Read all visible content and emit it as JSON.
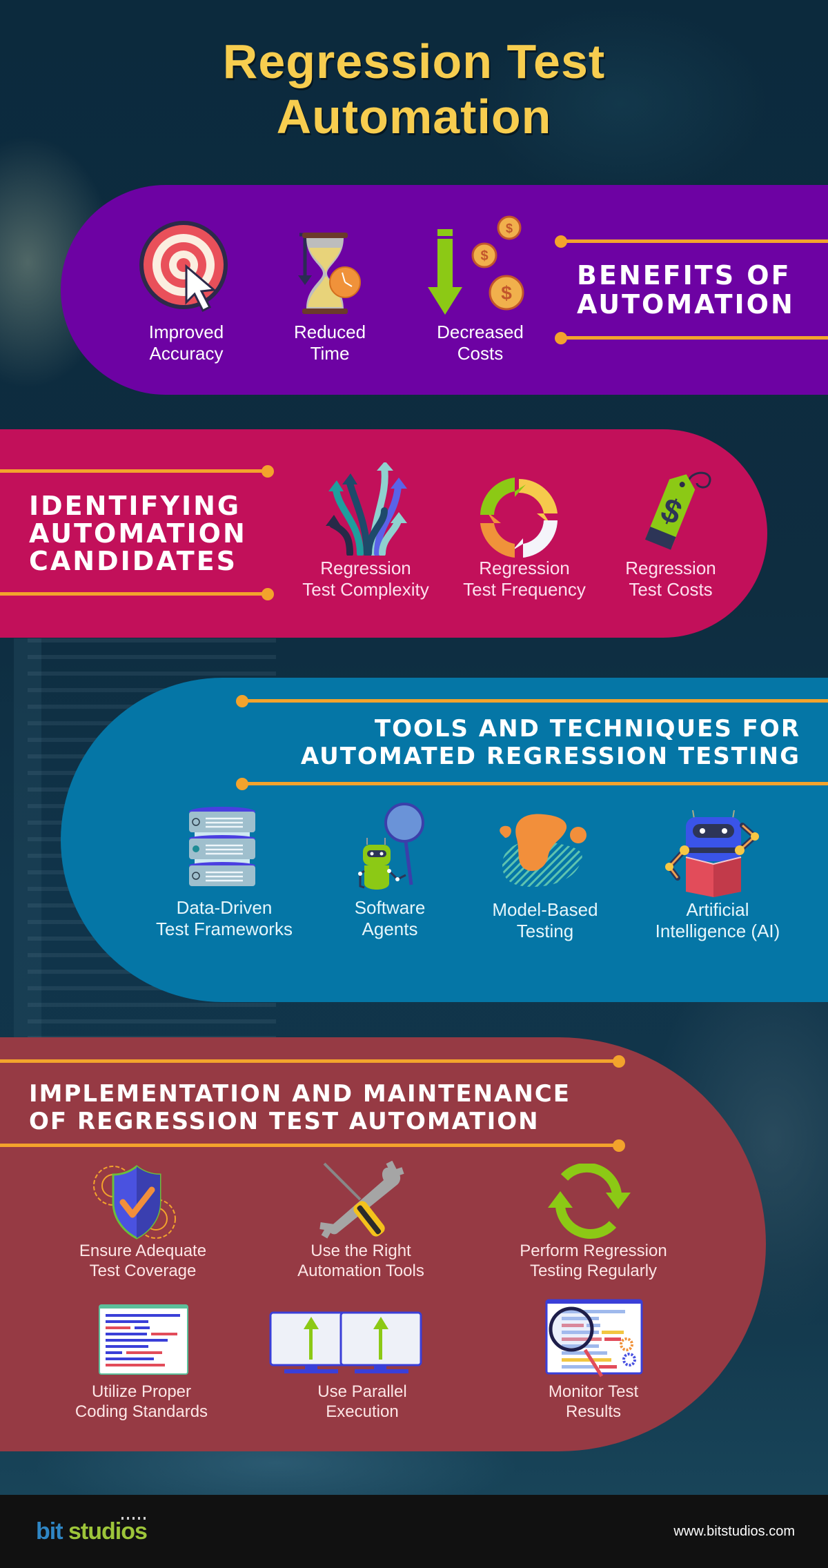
{
  "title": {
    "line1": "Regression Test",
    "line2": "Automation"
  },
  "colors": {
    "title": "#f7cd4f",
    "accent_line": "#f3a32c",
    "benefits_bg": "#6d02a3",
    "candidates_bg": "#c2105a",
    "tools_bg": "#0576a6",
    "implementation_bg": "#963a44",
    "footer_bg": "#111111"
  },
  "benefits": {
    "heading_line1": "BENEFITS OF",
    "heading_line2": "AUTOMATION",
    "items": [
      {
        "icon": "target-cursor-icon",
        "line1": "Improved",
        "line2": "Accuracy"
      },
      {
        "icon": "hourglass-clock-icon",
        "line1": "Reduced",
        "line2": "Time"
      },
      {
        "icon": "down-arrow-coins-icon",
        "line1": "Decreased",
        "line2": "Costs"
      }
    ]
  },
  "candidates": {
    "heading_line1": "IDENTIFYING",
    "heading_line2": "AUTOMATION",
    "heading_line3": "CANDIDATES",
    "items": [
      {
        "icon": "branching-arrows-icon",
        "line1": "Regression",
        "line2": "Test Complexity"
      },
      {
        "icon": "cycle-arrows-icon",
        "line1": "Regression",
        "line2": "Test Frequency"
      },
      {
        "icon": "price-tag-icon",
        "line1": "Regression",
        "line2": "Test Costs"
      }
    ]
  },
  "tools": {
    "heading_line1": "TOOLS AND TECHNIQUES FOR",
    "heading_line2": "AUTOMATED REGRESSION TESTING",
    "items": [
      {
        "icon": "database-stack-icon",
        "line1": "Data-Driven",
        "line2": "Test Frameworks"
      },
      {
        "icon": "robot-magnifier-icon",
        "line1": "Software",
        "line2": "Agents"
      },
      {
        "icon": "blob-model-icon",
        "line1": "Model-Based",
        "line2": "Testing"
      },
      {
        "icon": "robot-book-icon",
        "line1": "Artificial",
        "line2": "Intelligence (AI)"
      }
    ]
  },
  "implementation": {
    "heading_line1": "IMPLEMENTATION AND MAINTENANCE",
    "heading_line2": "OF REGRESSION TEST AUTOMATION",
    "items": [
      {
        "icon": "shield-check-gears-icon",
        "line1": "Ensure Adequate",
        "line2": "Test Coverage"
      },
      {
        "icon": "wrench-screwdriver-icon",
        "line1": "Use the Right",
        "line2": "Automation Tools"
      },
      {
        "icon": "refresh-arrows-icon",
        "line1": "Perform Regression",
        "line2": "Testing Regularly"
      },
      {
        "icon": "code-window-icon",
        "line1": "Utilize Proper",
        "line2": "Coding Standards"
      },
      {
        "icon": "dual-monitors-icon",
        "line1": "Use Parallel",
        "line2": "Execution"
      },
      {
        "icon": "report-magnifier-icon",
        "line1": "Monitor Test",
        "line2": "Results"
      }
    ]
  },
  "footer": {
    "brand_part1": "bit",
    "brand_part2": "studios",
    "website": "www.bitstudios.com"
  }
}
